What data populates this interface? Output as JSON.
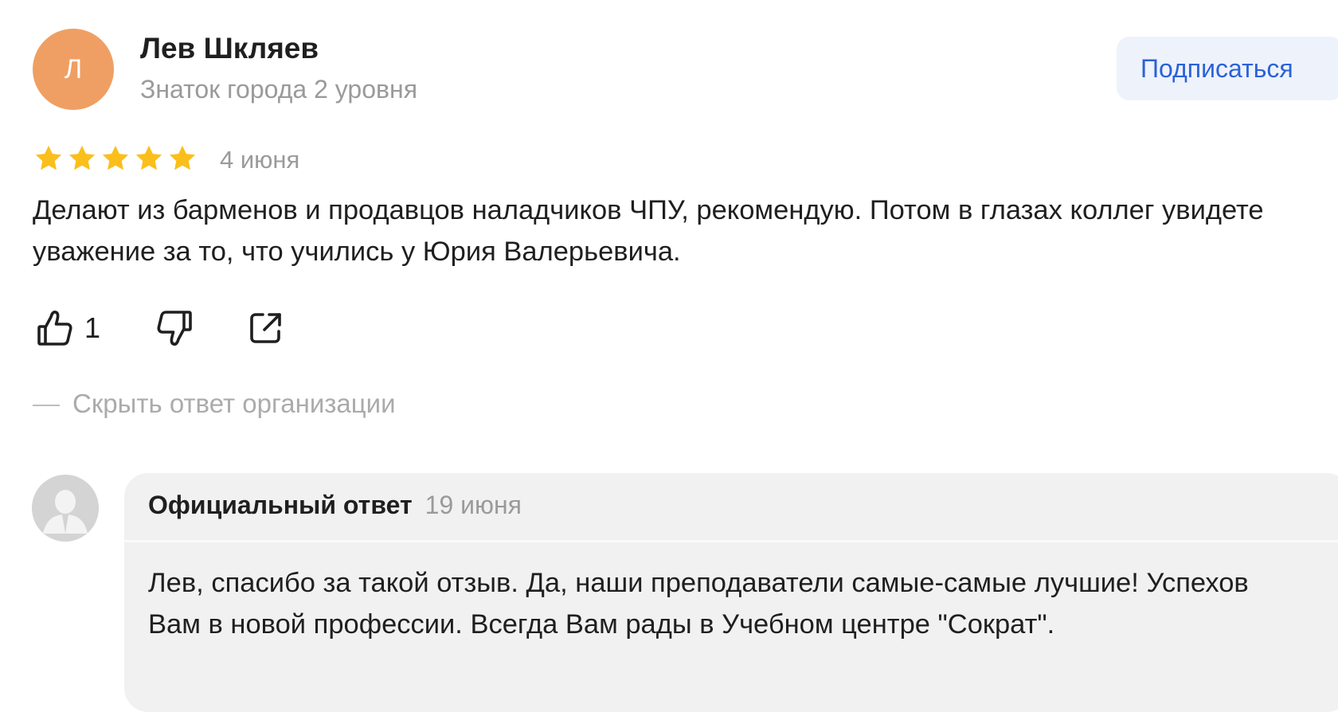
{
  "review": {
    "author": {
      "initial": "Л",
      "name": "Лев Шкляев",
      "level": "Знаток города 2 уровня",
      "avatar_color": "#ef9f63"
    },
    "subscribe_label": "Подписаться",
    "rating": 5,
    "rating_max": 5,
    "star_color": "#fbbf1c",
    "date": "4 июня",
    "text": "Делают из барменов и продавцов наладчиков ЧПУ, рекомендую. Потом в глазах коллег увидете уважение за то, что учились у Юрия Валерьевича.",
    "actions": {
      "like_icon": "thumbs-up-icon",
      "like_count": "1",
      "dislike_icon": "thumbs-down-icon",
      "share_icon": "share-icon"
    },
    "hide_reply_label": "Скрыть ответ организации"
  },
  "org_reply": {
    "avatar_icon": "organization-avatar-icon",
    "title": "Официальный ответ",
    "date": "19 июня",
    "text": "Лев, спасибо за такой отзыв. Да, наши преподаватели самые-самые лучшие! Успехов Вам в новой профессии. Всегда Вам рады в Учебном центре \"Сократ\"."
  },
  "colors": {
    "accent": "#2a62d8",
    "muted_text": "#9a9a9a",
    "reply_background": "#f1f1f1"
  }
}
